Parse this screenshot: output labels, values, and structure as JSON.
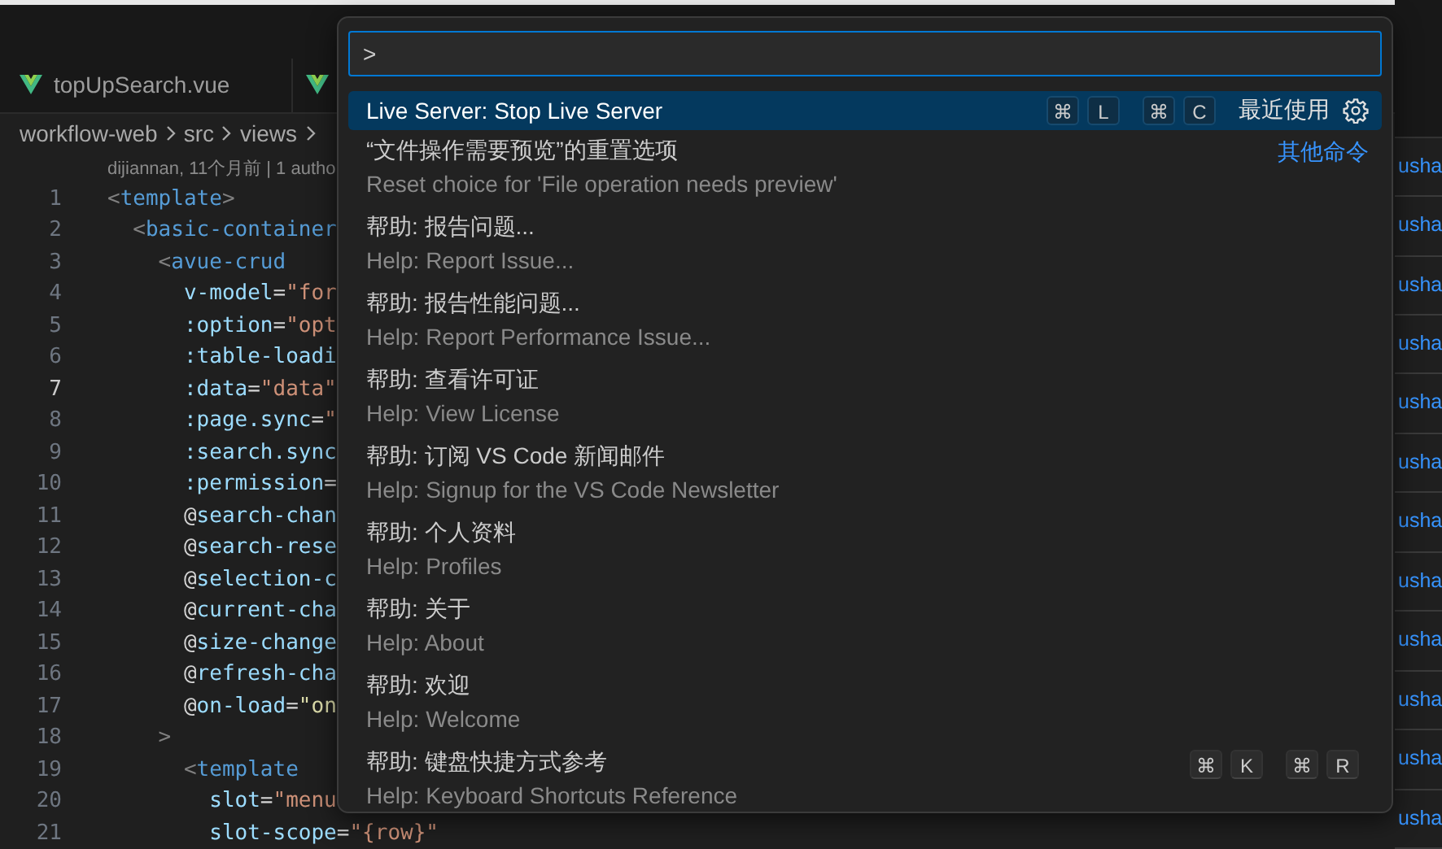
{
  "tabs": [
    {
      "kind": "labeled",
      "label": "topUpSearch.vue"
    },
    {
      "kind": "covered"
    }
  ],
  "breadcrumbs": [
    "workflow-web",
    "src",
    "views"
  ],
  "blame": "dijiannan, 11个月前 | 1 autho",
  "code_lines": [
    {
      "number": "1",
      "current": false,
      "tokens": [
        {
          "text": "<",
          "kind": "punct"
        },
        {
          "text": "template",
          "kind": "tag"
        },
        {
          "text": ">",
          "kind": "punct"
        }
      ]
    },
    {
      "number": "2",
      "current": false,
      "tokens": [
        {
          "text": "  <",
          "kind": "punct"
        },
        {
          "text": "basic-container",
          "kind": "tag"
        }
      ]
    },
    {
      "number": "3",
      "current": false,
      "tokens": [
        {
          "text": "    <",
          "kind": "punct"
        },
        {
          "text": "avue-crud",
          "kind": "tag"
        }
      ]
    },
    {
      "number": "4",
      "current": false,
      "tokens": [
        {
          "text": "      v-model",
          "kind": "attr"
        },
        {
          "text": "=",
          "kind": "plain"
        },
        {
          "text": "\"for",
          "kind": "string"
        }
      ]
    },
    {
      "number": "5",
      "current": false,
      "tokens": [
        {
          "text": "      :option",
          "kind": "attr"
        },
        {
          "text": "=",
          "kind": "plain"
        },
        {
          "text": "\"opt",
          "kind": "string"
        }
      ]
    },
    {
      "number": "6",
      "current": false,
      "tokens": [
        {
          "text": "      :table-loadi",
          "kind": "attr"
        }
      ]
    },
    {
      "number": "7",
      "current": true,
      "tokens": [
        {
          "text": "      :data",
          "kind": "attr"
        },
        {
          "text": "=",
          "kind": "plain"
        },
        {
          "text": "\"data\"",
          "kind": "string"
        }
      ]
    },
    {
      "number": "8",
      "current": false,
      "tokens": [
        {
          "text": "      :page.sync",
          "kind": "attr"
        },
        {
          "text": "=",
          "kind": "plain"
        },
        {
          "text": "\"",
          "kind": "string"
        }
      ]
    },
    {
      "number": "9",
      "current": false,
      "tokens": [
        {
          "text": "      :search.sync",
          "kind": "attr"
        }
      ]
    },
    {
      "number": "10",
      "current": false,
      "tokens": [
        {
          "text": "      :permission",
          "kind": "attr"
        },
        {
          "text": "=",
          "kind": "plain"
        }
      ]
    },
    {
      "number": "11",
      "current": false,
      "tokens": [
        {
          "text": "      @",
          "kind": "plain"
        },
        {
          "text": "search-chan",
          "kind": "attr"
        }
      ]
    },
    {
      "number": "12",
      "current": false,
      "tokens": [
        {
          "text": "      @",
          "kind": "plain"
        },
        {
          "text": "search-rese",
          "kind": "attr"
        }
      ]
    },
    {
      "number": "13",
      "current": false,
      "tokens": [
        {
          "text": "      @",
          "kind": "plain"
        },
        {
          "text": "selection-c",
          "kind": "attr"
        }
      ]
    },
    {
      "number": "14",
      "current": false,
      "tokens": [
        {
          "text": "      @",
          "kind": "plain"
        },
        {
          "text": "current-cha",
          "kind": "attr"
        }
      ]
    },
    {
      "number": "15",
      "current": false,
      "tokens": [
        {
          "text": "      @",
          "kind": "plain"
        },
        {
          "text": "size-change",
          "kind": "attr"
        }
      ]
    },
    {
      "number": "16",
      "current": false,
      "tokens": [
        {
          "text": "      @",
          "kind": "plain"
        },
        {
          "text": "refresh-cha",
          "kind": "attr"
        }
      ]
    },
    {
      "number": "17",
      "current": false,
      "tokens": [
        {
          "text": "      @",
          "kind": "plain"
        },
        {
          "text": "on-load",
          "kind": "attr"
        },
        {
          "text": "=",
          "kind": "plain"
        },
        {
          "text": "\"on",
          "kind": "func"
        }
      ]
    },
    {
      "number": "18",
      "current": false,
      "tokens": [
        {
          "text": "    >",
          "kind": "punct"
        }
      ]
    },
    {
      "number": "19",
      "current": false,
      "tokens": [
        {
          "text": "      <",
          "kind": "punct"
        },
        {
          "text": "template",
          "kind": "tag"
        }
      ]
    },
    {
      "number": "20",
      "current": false,
      "tokens": [
        {
          "text": "        slot",
          "kind": "attr"
        },
        {
          "text": "=",
          "kind": "plain"
        },
        {
          "text": "\"menu",
          "kind": "string"
        }
      ]
    },
    {
      "number": "21",
      "current": false,
      "tokens": [
        {
          "text": "        slot-scope",
          "kind": "attr"
        },
        {
          "text": "=",
          "kind": "plain"
        },
        {
          "text": "\"{row}\"",
          "kind": "string"
        }
      ]
    }
  ],
  "side_rows": [
    "usha",
    "usha",
    "usha",
    "usha",
    "usha",
    "usha",
    "usha",
    "usha",
    "usha",
    "usha",
    "usha",
    "usha"
  ],
  "command_palette": {
    "value": ">",
    "items": [
      {
        "title": "Live Server: Stop Live Server",
        "selected": true,
        "keys": [
          [
            "⌘",
            "L"
          ],
          [
            "⌘",
            "C"
          ]
        ],
        "tag": {
          "text": "最近使用",
          "kind": "recent"
        },
        "settings_button": true
      },
      {
        "title": "“文件操作需要预览”的重置选项",
        "subtitle": "Reset choice for 'File operation needs preview'",
        "selected": false,
        "tag": {
          "text": "其他命令",
          "kind": "group"
        },
        "settings_button": false
      },
      {
        "title": "帮助: 报告问题...",
        "subtitle": "Help: Report Issue...",
        "selected": false,
        "settings_button": false
      },
      {
        "title": "帮助: 报告性能问题...",
        "subtitle": "Help: Report Performance Issue...",
        "selected": false,
        "settings_button": false
      },
      {
        "title": "帮助: 查看许可证",
        "subtitle": "Help: View License",
        "selected": false,
        "settings_button": false
      },
      {
        "title": "帮助: 订阅 VS Code 新闻邮件",
        "subtitle": "Help: Signup for the VS Code Newsletter",
        "selected": false,
        "settings_button": false
      },
      {
        "title": "帮助: 个人资料",
        "subtitle": "Help: Profiles",
        "selected": false,
        "settings_button": false
      },
      {
        "title": "帮助: 关于",
        "subtitle": "Help: About",
        "selected": false,
        "settings_button": false
      },
      {
        "title": "帮助: 欢迎",
        "subtitle": "Help: Welcome",
        "selected": false,
        "settings_button": false
      },
      {
        "title": "帮助: 键盘快捷方式参考",
        "subtitle": "Help: Keyboard Shortcuts Reference",
        "selected": false,
        "keys": [
          [
            "⌘",
            "K"
          ],
          [
            "⌘",
            "R"
          ]
        ],
        "settings_button": false
      }
    ]
  }
}
